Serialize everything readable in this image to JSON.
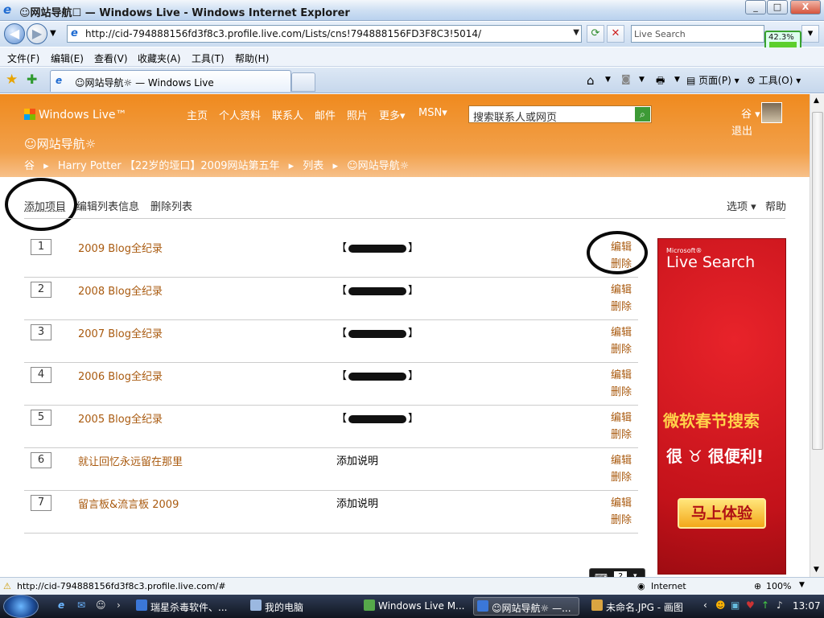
{
  "window": {
    "title": "☺网站导航☐ — Windows Live - Windows Internet Explorer",
    "min": "_",
    "max": "□",
    "close": "X"
  },
  "address": {
    "url": "http://cid-794888156fd3f8c3.profile.live.com/Lists/cns!794888156FD3F8C3!5014/",
    "search_placeholder": "Live Search"
  },
  "cpu_meter": {
    "percent": "42.3%"
  },
  "menu": [
    "文件(F)",
    "编辑(E)",
    "查看(V)",
    "收藏夹(A)",
    "工具(T)",
    "帮助(H)"
  ],
  "tab": {
    "label": "☺网站导航☼ — Windows Live"
  },
  "toolbar": {
    "page": "页面(P)",
    "tools": "工具(O)"
  },
  "page": {
    "brand": "Windows Live™",
    "nav": [
      "主页",
      "个人资料",
      "联系人",
      "邮件",
      "照片",
      "更多▾",
      "MSN▾"
    ],
    "search_placeholder": "搜索联系人或网页",
    "user": "谷 ▾",
    "logout": "退出",
    "title": "☺网站导航☼",
    "breadcrumbs": [
      "谷",
      "▸",
      "Harry Potter 【22岁的垭口】2009网站第五年",
      "▸",
      "列表",
      "▸",
      "☺网站导航☼"
    ],
    "actions": {
      "add": "添加项目",
      "edit_info": "编辑列表信息",
      "delete_list": "删除列表",
      "options": "选项 ▾",
      "help": "帮助"
    },
    "rows": [
      {
        "num": "1",
        "name": "2009 Blog全纪录",
        "desc_redacted": true,
        "desc": "",
        "edit": "编辑",
        "del": "删除"
      },
      {
        "num": "2",
        "name": "2008 Blog全纪录",
        "desc_redacted": true,
        "desc": "",
        "edit": "编辑",
        "del": "删除"
      },
      {
        "num": "3",
        "name": "2007 Blog全纪录",
        "desc_redacted": true,
        "desc": "",
        "edit": "编辑",
        "del": "删除"
      },
      {
        "num": "4",
        "name": "2006 Blog全纪录",
        "desc_redacted": true,
        "desc": "",
        "edit": "编辑",
        "del": "删除"
      },
      {
        "num": "5",
        "name": "2005 Blog全纪录",
        "desc_redacted": true,
        "desc": "",
        "edit": "编辑",
        "del": "删除"
      },
      {
        "num": "6",
        "name": "就让回忆永远留在那里",
        "desc_redacted": false,
        "desc": "添加说明",
        "edit": "编辑",
        "del": "删除"
      },
      {
        "num": "7",
        "name": "留言板&流言板 2009",
        "desc_redacted": false,
        "desc": "添加说明",
        "edit": "编辑",
        "del": "删除"
      }
    ],
    "ad": {
      "microsoft": "Microsoft®",
      "brand": "Live Search",
      "line1": "微软春节搜索",
      "line2": "很 ♉ 很便利!",
      "cta": "马上体验"
    }
  },
  "status": {
    "url": "http://cid-794888156fd3f8c3.profile.live.com/#",
    "zone": "Internet",
    "zoom": "100%"
  },
  "taskbar": {
    "items": [
      "瑞星杀毒软件、...",
      "我的电脑",
      "Windows Live M...",
      "☺网站导航☼ —...",
      "未命名.JPG - 画图"
    ],
    "clock": "13:07"
  }
}
